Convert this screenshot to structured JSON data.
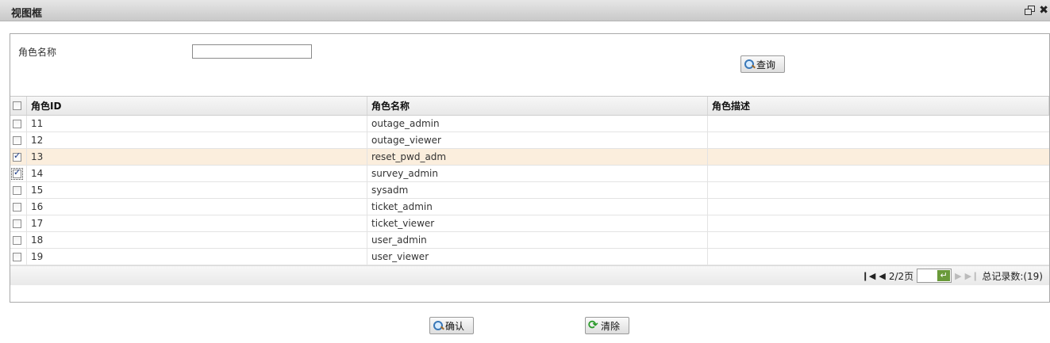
{
  "window": {
    "title": "视图框"
  },
  "search": {
    "label": "角色名称",
    "value": "",
    "button_label": "查询"
  },
  "table": {
    "columns": [
      "角色ID",
      "角色名称",
      "角色描述"
    ],
    "rows": [
      {
        "id": "11",
        "name": "outage_admin",
        "desc": "",
        "checked": false
      },
      {
        "id": "12",
        "name": "outage_viewer",
        "desc": "",
        "checked": false
      },
      {
        "id": "13",
        "name": "reset_pwd_adm",
        "desc": "",
        "checked": true
      },
      {
        "id": "14",
        "name": "survey_admin",
        "desc": "",
        "checked": true
      },
      {
        "id": "15",
        "name": "sysadm",
        "desc": "",
        "checked": false
      },
      {
        "id": "16",
        "name": "ticket_admin",
        "desc": "",
        "checked": false
      },
      {
        "id": "17",
        "name": "ticket_viewer",
        "desc": "",
        "checked": false
      },
      {
        "id": "18",
        "name": "user_admin",
        "desc": "",
        "checked": false
      },
      {
        "id": "19",
        "name": "user_viewer",
        "desc": "",
        "checked": false
      }
    ]
  },
  "pager": {
    "page_info": "2/2页",
    "total": "总记录数:(19)",
    "page_input": ""
  },
  "footer": {
    "confirm_label": "确认",
    "clear_label": "清除"
  },
  "colors": {
    "selected_row": "#fbeedd",
    "go_button": "#6a9a3a"
  }
}
